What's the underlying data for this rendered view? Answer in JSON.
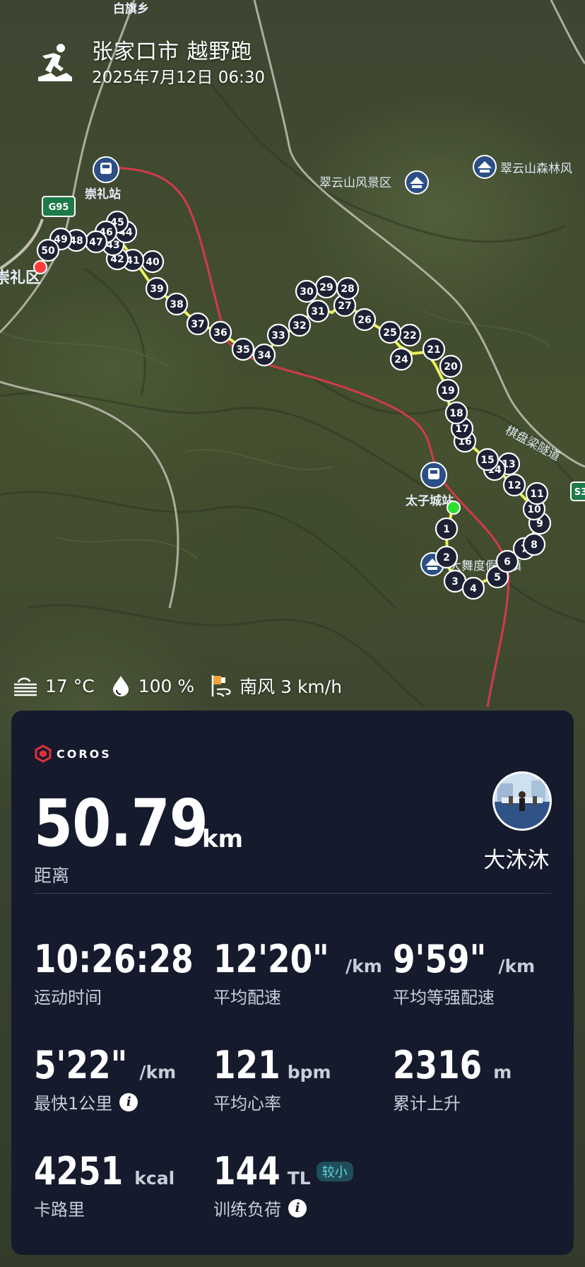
{
  "header": {
    "title": "张家口市 越野跑",
    "datetime": "2025年7月12日 06:30",
    "activity_icon": "trail-run-icon"
  },
  "map": {
    "place_labels": {
      "top_cut": "白旗乡",
      "chongli_station": "崇礼站",
      "chongli_district": "崇礼区",
      "highway_g95": "G95",
      "cuiyun_scenic": "翠云山风景区",
      "cuiyun_forest": "翠云山森林风",
      "taizicheng_station": "太子城站",
      "dancer_site": "大舞度假小镇",
      "tunnel_road": "棋盘梁隧道",
      "road_s3": "S3"
    },
    "km_markers": [
      "1",
      "2",
      "3",
      "4",
      "5",
      "6",
      "7",
      "8",
      "9",
      "10",
      "11",
      "12",
      "13",
      "14",
      "15",
      "16",
      "17",
      "18",
      "19",
      "20",
      "21",
      "22",
      "24",
      "25",
      "26",
      "27",
      "28",
      "29",
      "30",
      "31",
      "32",
      "33",
      "34",
      "35",
      "36",
      "37",
      "38",
      "39",
      "40",
      "41",
      "42",
      "43",
      "44",
      "45",
      "46",
      "47",
      "48",
      "49",
      "50"
    ],
    "start_color": "#2ee02e",
    "end_color": "#ff3b3b",
    "route_color": "#e8f25a",
    "rail_color": "#d23a4a"
  },
  "weather": {
    "temperature": "17 °C",
    "humidity": "100 %",
    "wind": "南风 3 km/h",
    "icons": [
      "fog-icon",
      "humidity-drop-icon",
      "wind-flag-icon"
    ]
  },
  "card": {
    "brand": "COROS",
    "distance": {
      "value": "50.79",
      "unit": "km",
      "label": "距离"
    },
    "user": {
      "name": "大沐沐"
    },
    "stats": [
      {
        "value": "10:26:28",
        "unit": "",
        "label": "运动时间"
      },
      {
        "value": "12'20\"",
        "unit": "/km",
        "label": "平均配速"
      },
      {
        "value": "9'59\"",
        "unit": "/km",
        "label": "平均等强配速"
      },
      {
        "value": "5'22\"",
        "unit": "/km",
        "label": "最快1公里"
      },
      {
        "value": "121",
        "unit": "bpm",
        "label": "平均心率"
      },
      {
        "value": "2316",
        "unit": "m",
        "label": "累计上升"
      },
      {
        "value": "4251",
        "unit": "kcal",
        "label": "卡路里"
      },
      {
        "value": "144",
        "unit": "TL",
        "label": "训练负荷",
        "badge": "较小"
      }
    ]
  }
}
